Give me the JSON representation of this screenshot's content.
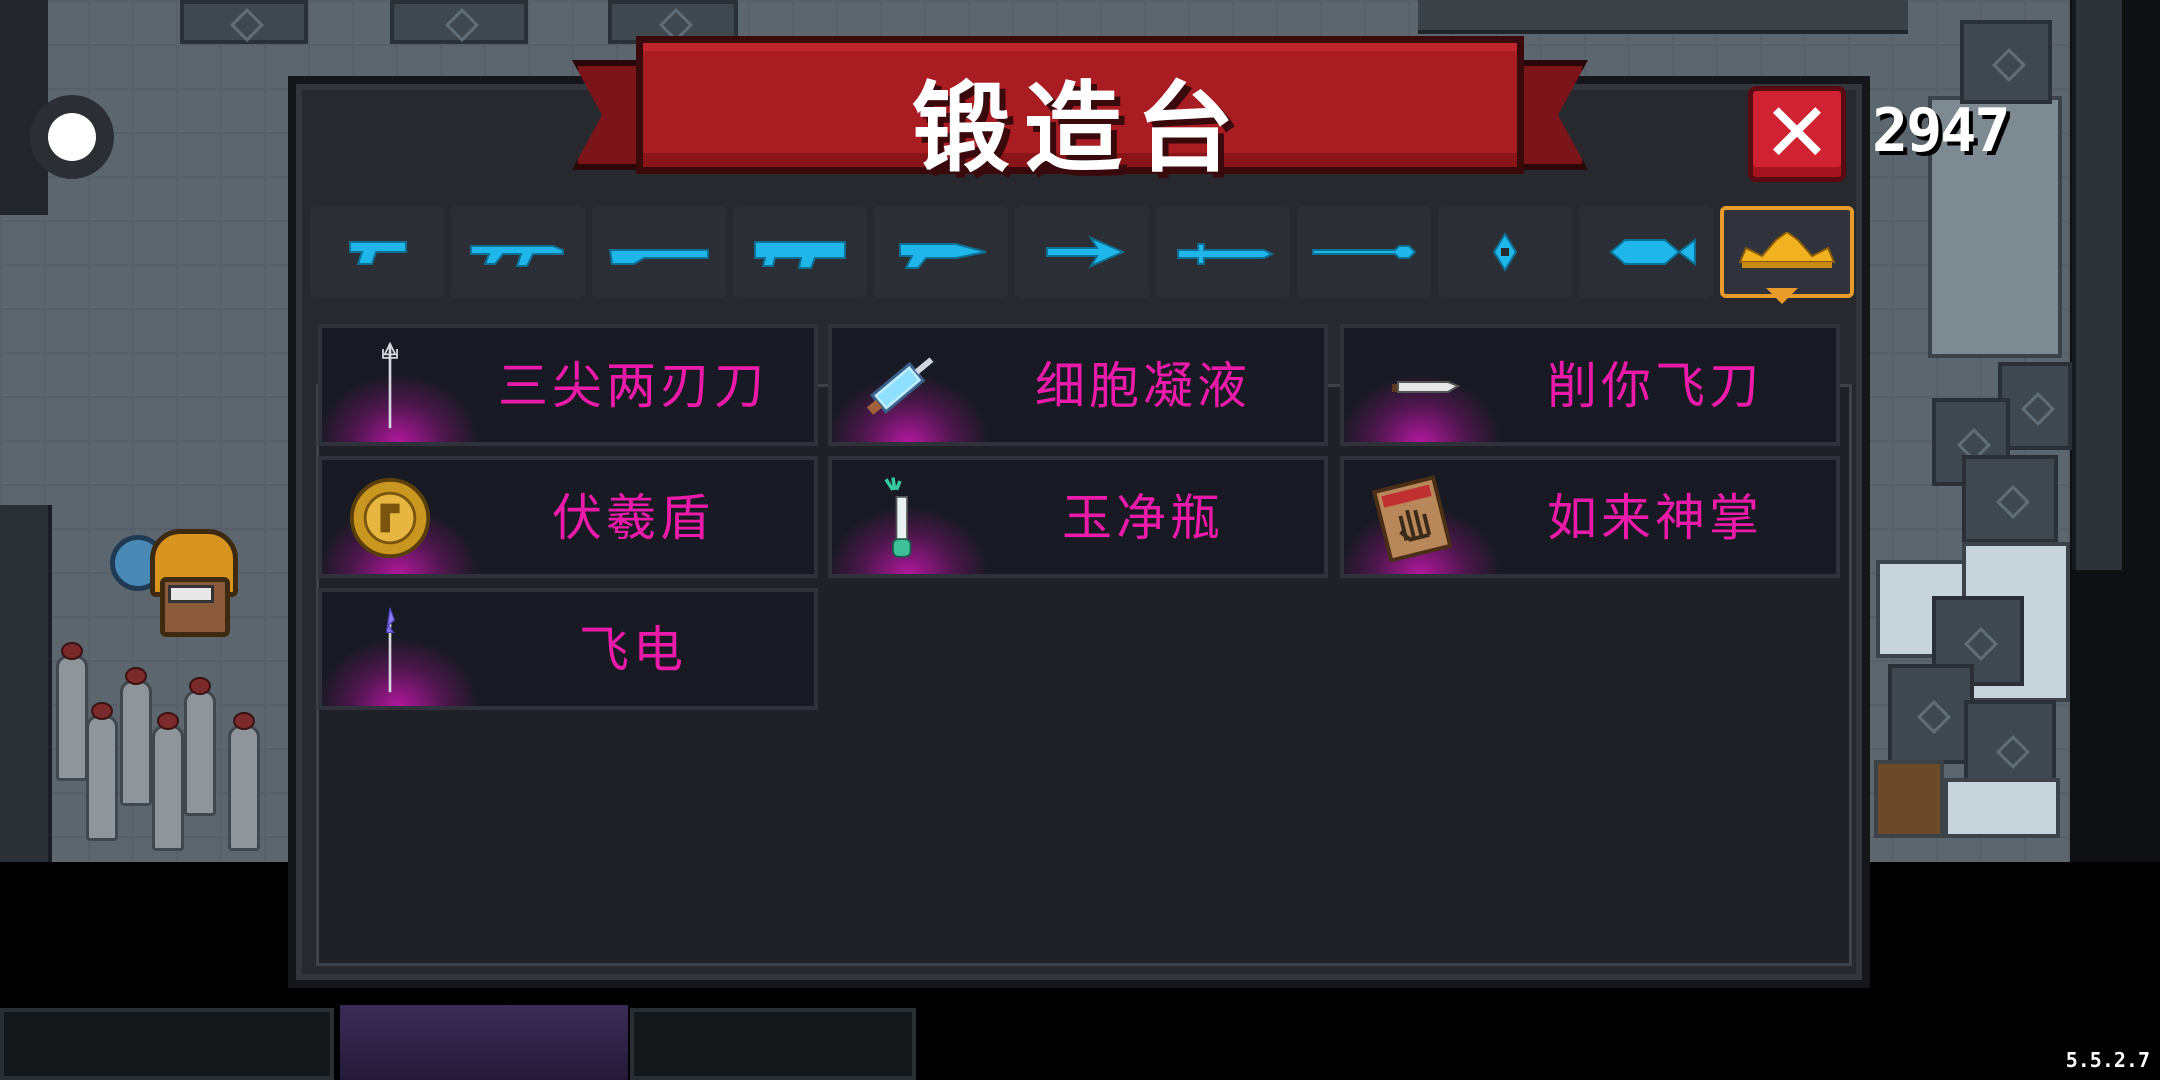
{
  "forge": {
    "title": "锻造台",
    "close_label": "✕"
  },
  "currency": {
    "amount": "2947"
  },
  "version": "5.5.2.7",
  "tabs": [
    {
      "icon": "pistol-icon",
      "selected": false
    },
    {
      "icon": "rifle-icon",
      "selected": false
    },
    {
      "icon": "shotgun-icon",
      "selected": false
    },
    {
      "icon": "launcher-icon",
      "selected": false
    },
    {
      "icon": "laser-gun-icon",
      "selected": false
    },
    {
      "icon": "bow-icon",
      "selected": false
    },
    {
      "icon": "sword-icon",
      "selected": false
    },
    {
      "icon": "spear-icon",
      "selected": false
    },
    {
      "icon": "shuriken-icon",
      "selected": false
    },
    {
      "icon": "fish-icon",
      "selected": false
    },
    {
      "icon": "crown-icon",
      "selected": true
    }
  ],
  "items": [
    {
      "name": "三尖两刃刀",
      "icon": "trident-icon"
    },
    {
      "name": "细胞凝液",
      "icon": "syringe-icon"
    },
    {
      "name": "削你飞刀",
      "icon": "knife-icon"
    },
    {
      "name": "伏羲盾",
      "icon": "gold-shield-icon"
    },
    {
      "name": "玉净瓶",
      "icon": "jade-vase-icon"
    },
    {
      "name": "如来神掌",
      "icon": "scroll-book-icon"
    },
    {
      "name": "飞电",
      "icon": "lightning-spear-icon"
    }
  ],
  "colors": {
    "item_text": "#ec1aa8",
    "tab_icon": "#1fb6ea",
    "tab_selected": "#e89b2a",
    "ribbon": "#a81c22"
  }
}
